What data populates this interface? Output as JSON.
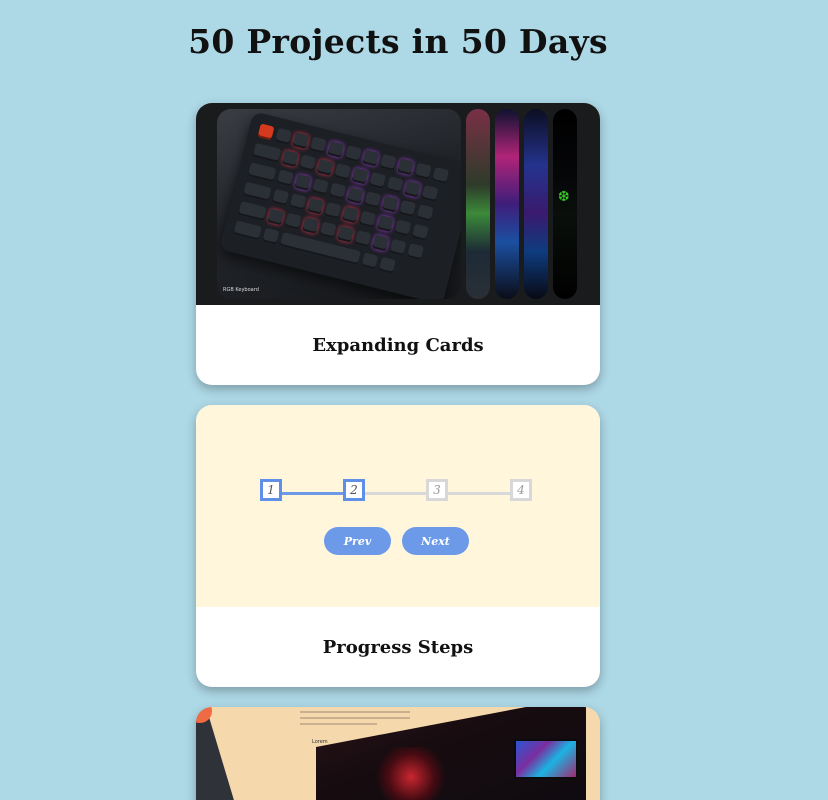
{
  "page": {
    "title": "50 Projects in 50 Days",
    "background_color": "#add8e6"
  },
  "projects": [
    {
      "name": "Expanding Cards",
      "preview_caption": "RGB Keyboard",
      "preview_icon": "razer-logo"
    },
    {
      "name": "Progress Steps",
      "preview": {
        "steps": [
          "1",
          "2",
          "3",
          "4"
        ],
        "active_steps": 2,
        "accent_color": "#6c99e8",
        "prev_label": "Prev",
        "next_label": "Next"
      }
    },
    {
      "name": "",
      "preview_label": "Lorem"
    }
  ]
}
